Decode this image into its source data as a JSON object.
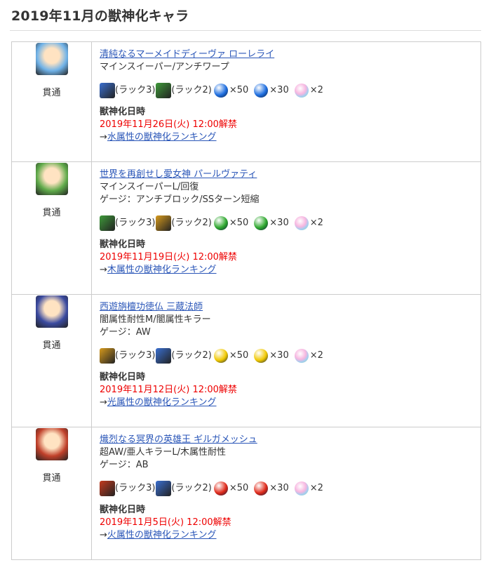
{
  "page_title": "2019年11月の獣神化キャラ",
  "chars": [
    {
      "name": "清純なるマーメイドディーヴァ ローレライ",
      "type": "貫通",
      "abilities": [
        "マインスイーパー/アンチワープ"
      ],
      "mats": [
        {
          "icon": "blue-material-icon",
          "label": "(ラック3)"
        },
        {
          "icon": "green-material-icon",
          "label": "(ラック2)"
        }
      ],
      "orbs": [
        {
          "icon": "water-big-orb-icon",
          "label": "×50"
        },
        {
          "icon": "water-orb-icon",
          "label": "×30"
        },
        {
          "icon": "rainbow-orb-icon",
          "label": "×2"
        }
      ],
      "date_label": "獣神化日時",
      "date": "2019年11月26日(火) 12:00解禁",
      "ranking_arrow": "→",
      "ranking": "水属性の獣神化ランキング",
      "colors": {
        "portrait": "#6fb2e8",
        "mat1": "#3a6fd0",
        "mat2": "#3f9a3a",
        "orb": "#1f6fe0"
      }
    },
    {
      "name": "世界を再創せし愛女神 パールヴァティ",
      "type": "貫通",
      "abilities": [
        "マインスイーパーL/回復",
        "ゲージ：アンチブロック/SSターン短縮"
      ],
      "mats": [
        {
          "icon": "green-material-icon",
          "label": "(ラック3)"
        },
        {
          "icon": "gold-material-icon",
          "label": "(ラック2)"
        }
      ],
      "orbs": [
        {
          "icon": "wood-big-orb-icon",
          "label": "×50"
        },
        {
          "icon": "wood-orb-icon",
          "label": "×30"
        },
        {
          "icon": "rainbow-orb-icon",
          "label": "×2"
        }
      ],
      "date_label": "獣神化日時",
      "date": "2019年11月19日(火) 12:00解禁",
      "ranking_arrow": "→",
      "ranking": "木属性の獣神化ランキング",
      "colors": {
        "portrait": "#5faa4a",
        "mat1": "#3f9a3a",
        "mat2": "#d69a1d",
        "orb": "#2fa82f"
      }
    },
    {
      "name": "西遊旃檀功徳仏 三蔵法師",
      "type": "貫通",
      "abilities": [
        "闇属性耐性M/闇属性キラー",
        "ゲージ：AW"
      ],
      "mats": [
        {
          "icon": "gold-material-icon",
          "label": "(ラック3)"
        },
        {
          "icon": "blue-material-icon",
          "label": "(ラック2)"
        }
      ],
      "orbs": [
        {
          "icon": "light-big-orb-icon",
          "label": "×50"
        },
        {
          "icon": "light-orb-icon",
          "label": "×30"
        },
        {
          "icon": "rainbow-orb-icon",
          "label": "×2"
        }
      ],
      "date_label": "獣神化日時",
      "date": "2019年11月12日(火) 12:00解禁",
      "ranking_arrow": "→",
      "ranking": "光属性の獣神化ランキング",
      "colors": {
        "portrait": "#3a4aa0",
        "mat1": "#d69a1d",
        "mat2": "#3a6fd0",
        "orb": "#f0c800"
      }
    },
    {
      "name": "熾烈なる冥界の英雄王 ギルガメッシュ",
      "type": "貫通",
      "abilities": [
        "超AW/亜人キラーL/木属性耐性",
        "ゲージ：AB"
      ],
      "mats": [
        {
          "icon": "red-material-icon",
          "label": "(ラック3)"
        },
        {
          "icon": "blue-material-icon",
          "label": "(ラック2)"
        }
      ],
      "orbs": [
        {
          "icon": "fire-big-orb-icon",
          "label": "×50"
        },
        {
          "icon": "fire-orb-icon",
          "label": "×30"
        },
        {
          "icon": "rainbow-orb-icon",
          "label": "×2"
        }
      ],
      "date_label": "獣神化日時",
      "date": "2019年11月5日(火) 12:00解禁",
      "ranking_arrow": "→",
      "ranking": "火属性の獣神化ランキング",
      "colors": {
        "portrait": "#c0402a",
        "mat1": "#c43a1e",
        "mat2": "#3a6fd0",
        "orb": "#e02a1a"
      }
    }
  ]
}
